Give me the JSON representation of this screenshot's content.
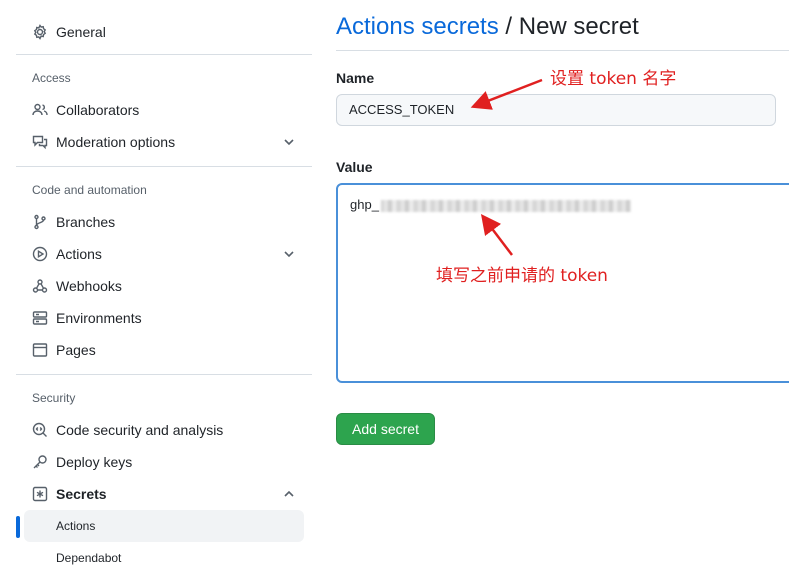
{
  "sidebar": {
    "general": "General",
    "access_title": "Access",
    "collaborators": "Collaborators",
    "moderation": "Moderation options",
    "code_title": "Code and automation",
    "branches": "Branches",
    "actions": "Actions",
    "webhooks": "Webhooks",
    "environments": "Environments",
    "pages": "Pages",
    "security_title": "Security",
    "code_security": "Code security and analysis",
    "deploy_keys": "Deploy keys",
    "secrets": "Secrets",
    "secrets_sub": [
      "Actions",
      "Dependabot"
    ]
  },
  "main": {
    "title_link": "Actions secrets",
    "title_rest": " / New secret",
    "name_label": "Name",
    "name_value": "ACCESS_TOKEN",
    "value_label": "Value",
    "value_prefix": "ghp_",
    "submit": "Add secret"
  },
  "annotations": {
    "name_note": "设置 token 名字",
    "value_note": "填写之前申请的 token"
  },
  "colors": {
    "link": "#0969da",
    "button": "#2da44e",
    "annotation": "#e02020",
    "active_bar": "#0969da"
  }
}
